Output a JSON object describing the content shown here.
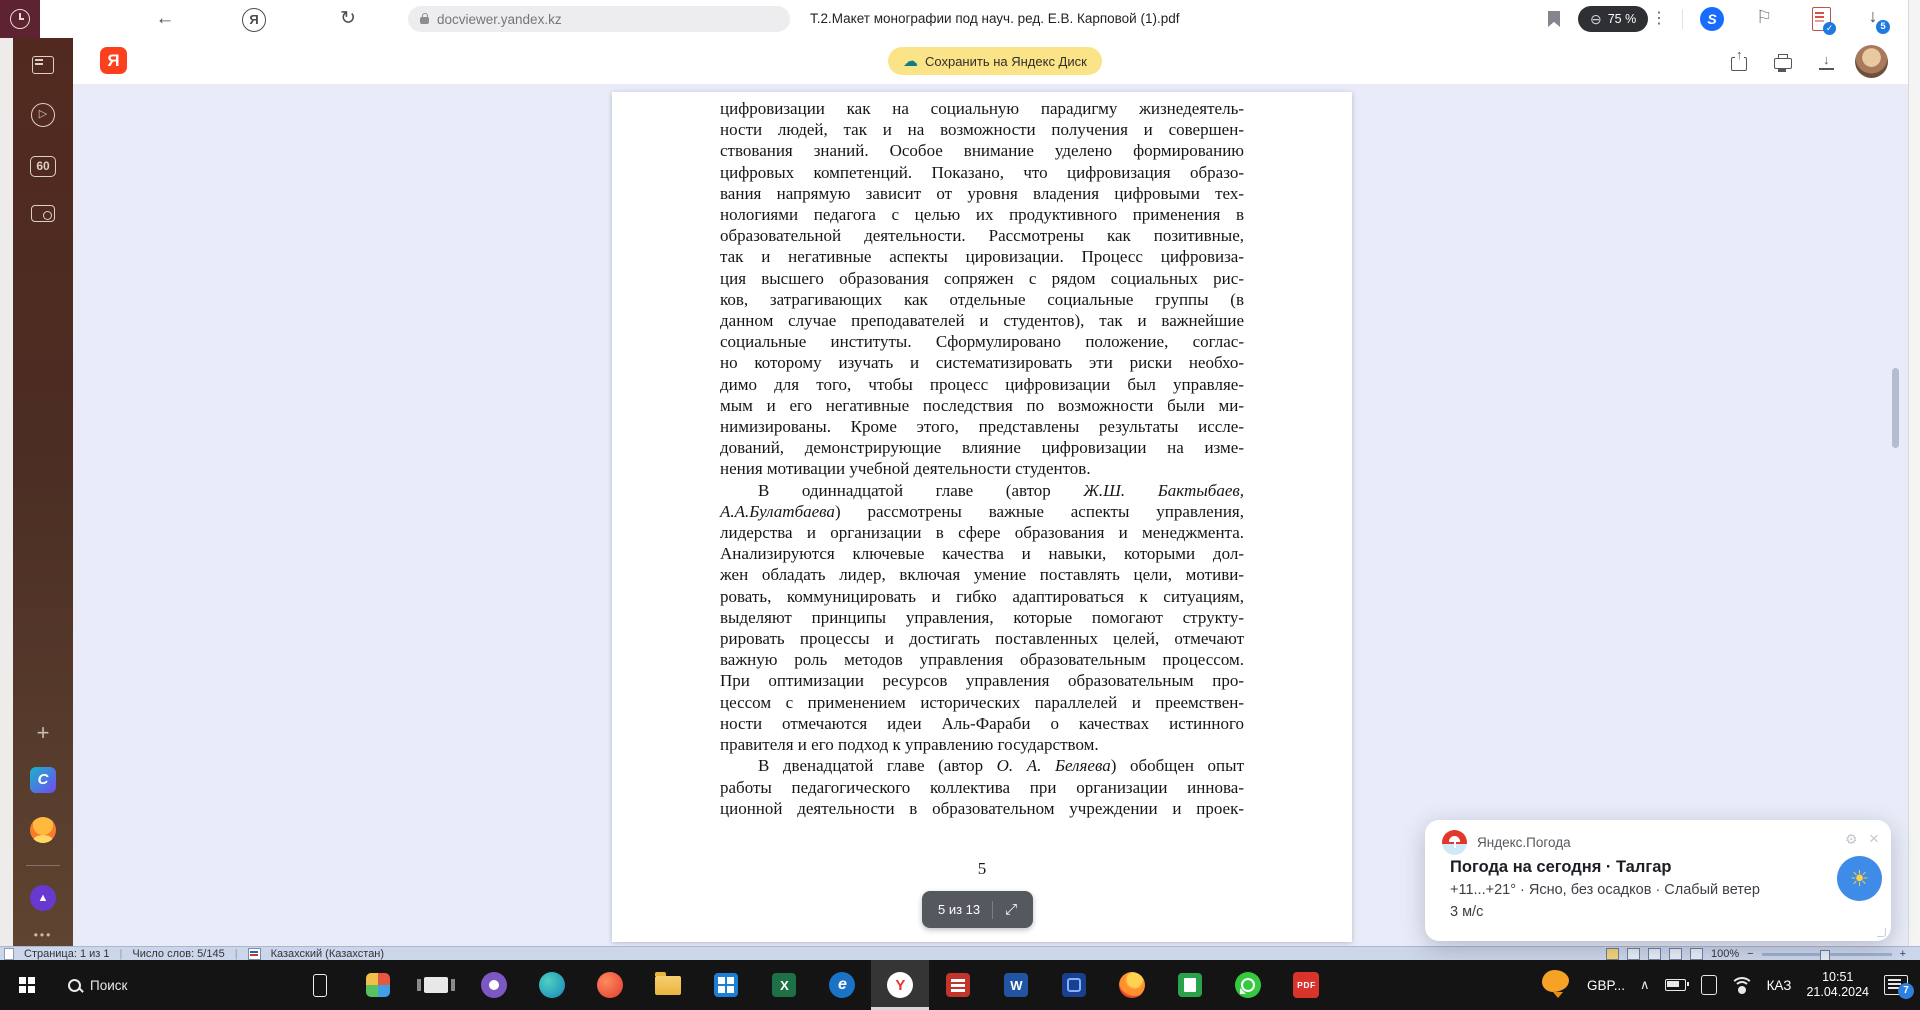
{
  "glyphs": {
    "back": "←",
    "reload": "↻",
    "yandex_y": "Я",
    "kebab": "⋮",
    "zoom_minus": "⊖",
    "shazam_s": "S",
    "flag": "⚐",
    "check": "✓",
    "down_arrow": "↓",
    "play": "▷",
    "plus": "+",
    "dots": "•••",
    "canva_c": "C",
    "alice_triangle": "▲",
    "expand": "⤢",
    "chevron_up": "∧",
    "close": "×",
    "gear": "⚙",
    "sun": "☀",
    "cloud": "☁",
    "minus": "−",
    "plus_small": "+",
    "word_w": "W",
    "excel_x": "X",
    "edge_e": "e",
    "yandex_browser_y": "Y",
    "pdf_label": "PDF"
  },
  "browser": {
    "toolbar": {
      "url": "docviewer.yandex.kz",
      "title": "Т.2.Макет монографии под науч. ред. Е.В. Карповой (1).pdf",
      "zoom_badge": "75 %",
      "download_badge": "5"
    },
    "header": {
      "save_button": "Сохранить на Яндекс Диск"
    },
    "sidebar": {
      "counter_badge": "60"
    }
  },
  "pdf": {
    "page_label": "5",
    "pager_label": "5 из 13",
    "lines": [
      "цифровизации  как на социальную парадигму жизнедеятель-",
      "ности людей, так и на возможности получения и совершен-",
      "ствования знаний. Особое внимание уделено формированию",
      "цифровых компетенций. Показано, что цифровизация образо-",
      "вания напрямую зависит от уровня владения цифровыми тех-",
      "нологиями педагога с целью их продуктивного применения в",
      "образовательной деятельности. Рассмотрены как позитивные,",
      "так и негативные аспекты цировизации. Процесс цифровиза-",
      "ция высшего образования сопряжен с рядом социальных рис-",
      "ков, затрагивающих как отдельные социальные группы (в",
      "данном случае преподавателей и студентов), так и важнейшие",
      "социальные институты. Сформулировано положение, соглас-",
      "но которому изучать и систематизировать эти риски необхо-",
      "димо для того, чтобы процесс цифровизации был управляе-",
      "мым и его негативные последствия по возможности были ми-",
      "нимизированы. Кроме этого, представлены результаты иссле-",
      "дований, демонстрирующие влияние цифровизации на изме-",
      {
        "t": "нения мотивации учебной деятельности студентов.",
        "end": 1
      },
      {
        "segs": [
          [
            "В  одиннадцатой  главе  (автор  ",
            0
          ],
          [
            "Ж.Ш.  Бактыбаев,",
            1
          ]
        ],
        "ind": 1
      },
      {
        "segs": [
          [
            "А.А.Булатбаева",
            1
          ],
          [
            ") рассмотрены важные аспекты управления,",
            0
          ]
        ]
      },
      "лидерства и организации в сфере образования и менеджмента.",
      "Анализируются ключевые качества и навыки, которыми дол-",
      "жен обладать лидер, включая умение поставлять цели, мотиви-",
      "ровать, коммуницировать и гибко адаптироваться к ситуациям,",
      "выделяют принципы управления, которые помогают структу-",
      "рировать процессы и достигать поставленных целей, отмечают",
      "важную роль методов управления образовательным процессом.",
      "При оптимизации ресурсов управления образовательным про-",
      "цессом с применением исторических параллелей и преемствен-",
      "ности  отмечаются  идеи  Аль-Фараби  о  качествах  истинного",
      {
        "t": "правителя и его подход к управлению государством.",
        "end": 1
      },
      {
        "segs": [
          [
            "В двенадцатой  главе (автор ",
            0
          ],
          [
            "О. А. Беляева",
            1
          ],
          [
            ") обобщен опыт",
            0
          ]
        ],
        "ind": 1
      },
      "работы педагогического коллектива при организации иннова-",
      "ционной деятельности в образовательном учреждении и проек-"
    ]
  },
  "weather": {
    "app": "Яндекс.Погода",
    "title": "Погода на сегодня · Талгар",
    "line1": "+11...+21° · Ясно, без осадков · Слабый ветер",
    "line2": "3 м/с"
  },
  "wordbar": {
    "page": "Страница: 1 из 1",
    "words": "Число слов: 5/145",
    "language": "Казахский (Казахстан)",
    "zoom": "100%"
  },
  "taskbar": {
    "search_label": "Поиск",
    "apps": [
      {
        "name": "phone-app-icon",
        "cls": "ic-phone",
        "shape": 1
      },
      {
        "name": "photos-app-icon",
        "cls": "ic-photos",
        "shape": 1
      },
      {
        "name": "task-view-icon",
        "cls": "ic-taskview",
        "shape": 1
      },
      {
        "name": "purple-app-icon",
        "cls": "ic ic-purple",
        "dot": 1
      },
      {
        "name": "teal-app-icon",
        "cls": "ic ic-teal"
      },
      {
        "name": "orange-app-icon",
        "cls": "ic ic-orange2"
      },
      {
        "name": "file-explorer-icon",
        "cls": "ic-folder",
        "shape": 1
      },
      {
        "name": "blue-tiles-app-icon",
        "cls": "ic-store",
        "shape": 1
      },
      {
        "name": "excel-icon",
        "cls": "ic-excel",
        "glyph": "excel_x",
        "shape": 1
      },
      {
        "name": "blue-e-browser-icon",
        "cls": "ic ic-bluee",
        "glyph": "edge_e"
      },
      {
        "name": "yandex-browser-icon",
        "cls": "ic ic-yandex",
        "glyph": "yandex_browser_y",
        "active": 1
      },
      {
        "name": "red-app-icon",
        "cls": "ic-redapp",
        "shape": 1
      },
      {
        "name": "word-icon",
        "cls": "ic-word",
        "glyph": "word_w",
        "shape": 1
      },
      {
        "name": "blue-app-icon",
        "cls": "ic-blueapp",
        "shape": 1
      },
      {
        "name": "firefox-like-browser-icon",
        "cls": "ic ic-fire"
      },
      {
        "name": "green-app-icon",
        "cls": "ic-green",
        "shape": 1
      },
      {
        "name": "whatsapp-icon",
        "cls": "ic ic-whatsapp"
      },
      {
        "name": "pdf-app-icon",
        "cls": "ic-pdf",
        "glyph": "pdf_label",
        "shape": 1
      }
    ],
    "tray": {
      "currency": "GBP...",
      "lang": "КАЗ",
      "time": "10:51",
      "date": "21.04.2024",
      "notif_badge": "7"
    }
  }
}
